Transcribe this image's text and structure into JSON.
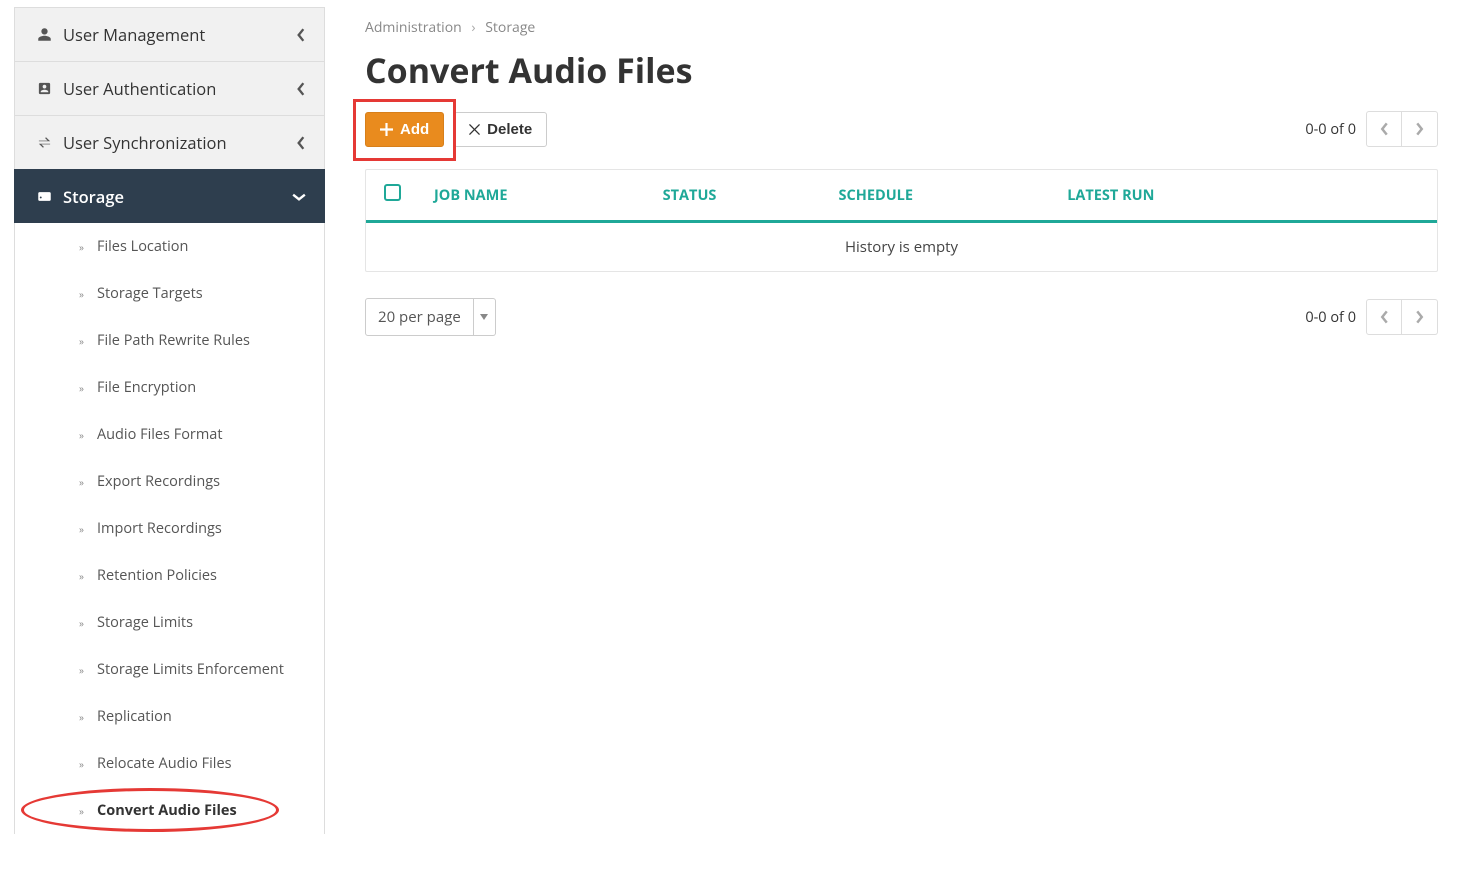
{
  "sidebar": {
    "sections": [
      {
        "label": "User Management",
        "icon": "user",
        "expanded": false
      },
      {
        "label": "User Authentication",
        "icon": "id-badge",
        "expanded": false
      },
      {
        "label": "User Synchronization",
        "icon": "sync",
        "expanded": false
      },
      {
        "label": "Storage",
        "icon": "hdd",
        "expanded": true
      }
    ],
    "storage_items": [
      {
        "label": "Files Location"
      },
      {
        "label": "Storage Targets"
      },
      {
        "label": "File Path Rewrite Rules"
      },
      {
        "label": "File Encryption"
      },
      {
        "label": "Audio Files Format"
      },
      {
        "label": "Export Recordings"
      },
      {
        "label": "Import Recordings"
      },
      {
        "label": "Retention Policies"
      },
      {
        "label": "Storage Limits"
      },
      {
        "label": "Storage Limits Enforcement"
      },
      {
        "label": "Replication"
      },
      {
        "label": "Relocate Audio Files"
      },
      {
        "label": "Convert Audio Files",
        "active": true
      }
    ]
  },
  "breadcrumb": {
    "part1": "Administration",
    "part2": "Storage"
  },
  "page_title": "Convert Audio Files",
  "toolbar": {
    "add": "Add",
    "delete": "Delete"
  },
  "table": {
    "headers": {
      "job": "Job Name",
      "status": "Status",
      "schedule": "Schedule",
      "latest": "Latest Run"
    },
    "empty_text": "History is empty"
  },
  "pager": {
    "range": "0-0 of 0"
  },
  "page_select": {
    "label": "20 per page"
  }
}
